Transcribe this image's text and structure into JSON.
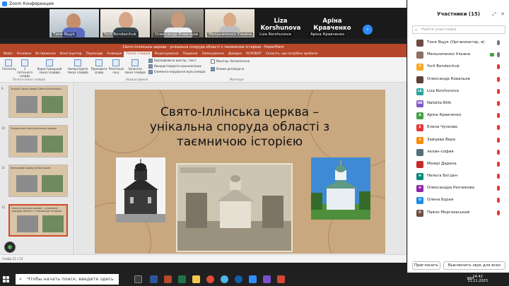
{
  "zoom": {
    "window_title": "Zoom Конференция",
    "next_icon": "chevron-right-icon"
  },
  "video_tiles": [
    {
      "name": "Таня Ящук"
    },
    {
      "name": "Yurii Bondarchuk"
    },
    {
      "name": "Олександр Ковальов"
    },
    {
      "name": "Мельниченко Ульяна"
    },
    {
      "name": "Liza Korshunova",
      "big": "Liza Korshunova"
    },
    {
      "name": "Аріна Кравченко",
      "big": "Аріна Кравченко"
    }
  ],
  "powerpoint": {
    "title": "Свято-Іллінська церква - унікальна споруда області з таємничою історією - PowerPoint",
    "tabs": [
      "Файл",
      "Основна",
      "Вставлення",
      "Конструктор",
      "Переходи",
      "Анімація",
      "Показ слайдів",
      "Рецензування",
      "Подання",
      "Записування",
      "Довідка",
      "ACROBAT",
      "Скажіть, що потрібно зробити"
    ],
    "active_tab": "Показ слайдів",
    "ribbon": {
      "buttons": [
        "Спочатку",
        "З поточного слайда",
        "Користувацький показ слайдів",
        "Налаштувати показ слайдів",
        "Приховати слайд",
        "Репетиція часу",
        "Записати показ слайдів"
      ],
      "checkboxes": [
        "Відтворювати диктор. текст",
        "Використовувати хронометраж",
        "Елементи керування мультимедіа",
        "Режим доповідача"
      ],
      "monitor_label": "Монітор: Автоматично",
      "groups": [
        "Почати показ слайдів",
        "Налаштування",
        "Монітори"
      ]
    },
    "slide_numbers": [
      "9",
      "10",
      "11",
      "12"
    ],
    "thumbs": [
      {
        "title": "Згадки і фото храму Свято-Іллінського"
      },
      {
        "title": "Згадки про Свято-Іллінську церкву"
      },
      {
        "title": "Фотографії храму різних років"
      },
      {
        "title": "Свято-Іллінська церква – унікальна споруда області з таємничою історією"
      }
    ],
    "slide_title": "Свято-Іллінська церква – унікальна споруда області з таємничою історією",
    "status_text": "Слайд 12 з 12"
  },
  "participants": {
    "title": "Участники (15)",
    "search_placeholder": "Найти участника",
    "list": [
      {
        "initials": "",
        "name": "Таня Ящук (Организатор, я)",
        "color": "#6d4c41",
        "mic": "gray",
        "cam": false
      },
      {
        "initials": "",
        "name": "Мельниченко Ульяна",
        "color": "#8d6e63",
        "mic": "gray",
        "cam": true
      },
      {
        "initials": "Y",
        "name": "Yurii Bondarchuk",
        "color": "#f9a825",
        "mic": "red",
        "cam": false
      },
      {
        "initials": "",
        "name": "Олександр Ковальов",
        "color": "#5d4037",
        "mic": "red",
        "cam": false
      },
      {
        "initials": "LK",
        "name": "Liza Korshunova",
        "color": "#26a69a",
        "mic": "red",
        "cam": false
      },
      {
        "initials": "NB",
        "name": "Nataliia Bilik",
        "color": "#7e57c2",
        "mic": "red",
        "cam": false
      },
      {
        "initials": "A",
        "name": "Аріна Кравченко",
        "color": "#43a047",
        "mic": "red",
        "cam": false
      },
      {
        "initials": "E",
        "name": "Елена Чулкова",
        "color": "#e53935",
        "mic": "red",
        "cam": false
      },
      {
        "initials": "З",
        "name": "Зайцева Вера",
        "color": "#fb8c00",
        "mic": "red",
        "cam": false
      },
      {
        "initials": "",
        "name": "лелин-софия",
        "color": "#546e7a",
        "mic": "red",
        "cam": false
      },
      {
        "initials": "",
        "name": "Мінері Дарина",
        "color": "#c62828",
        "mic": "red",
        "cam": false
      },
      {
        "initials": "Н",
        "name": "Нельга Богдан",
        "color": "#00897b",
        "mic": "red",
        "cam": false
      },
      {
        "initials": "O",
        "name": "Олександра Рехчикова",
        "color": "#8e24aa",
        "mic": "red",
        "cam": false
      },
      {
        "initials": "O",
        "name": "Олена Бурая",
        "color": "#1e88e5",
        "mic": "red",
        "cam": false
      },
      {
        "initials": "П",
        "name": "Павло Моргоєвський",
        "color": "#6d4c41",
        "mic": "red",
        "cam": false
      }
    ],
    "invite_label": "Пригласить",
    "mute_all_label": "Выключить звук для всех"
  },
  "taskbar": {
    "search_placeholder": "Чтобы начать поиск, введите здесь запрос",
    "lang": "УКР",
    "time": "14:42",
    "date": "11.11.2023"
  }
}
